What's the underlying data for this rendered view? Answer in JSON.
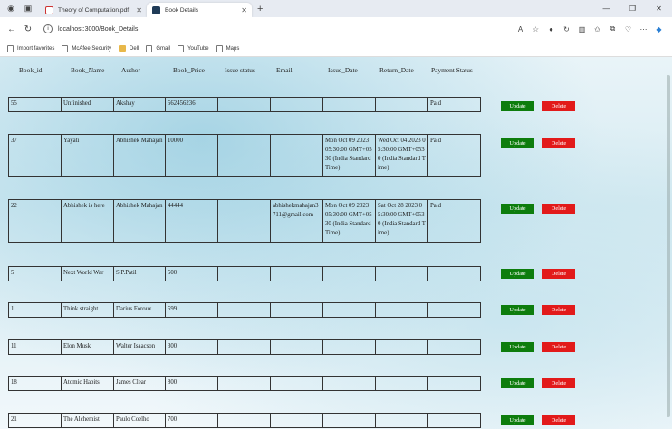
{
  "browser": {
    "tabs": [
      {
        "title": "Theory of Computation.pdf"
      },
      {
        "title": "Book Details"
      }
    ],
    "url": "localhost:3000/Book_Details",
    "favorites": [
      "Import favorites",
      "McAfee Security",
      "Dell",
      "Gmail",
      "YouTube",
      "Maps"
    ]
  },
  "table": {
    "headers": [
      "Book_id",
      "Book_Name",
      "Author",
      "Book_Price",
      "Issue status",
      "Email",
      "Issue_Date",
      "Return_Date",
      "Payment Status"
    ],
    "update_label": "Update",
    "delete_label": "Delete",
    "rows": [
      {
        "id": "55",
        "name": "Unfinished",
        "author": "Akshay",
        "price": "562456236",
        "status": "",
        "email": "",
        "issue": "",
        "ret": "",
        "payment": "Paid"
      },
      {
        "id": "37",
        "name": "Yayati",
        "author": "Abhishek Mahajan",
        "price": "10000",
        "status": "",
        "email": "",
        "issue": "Mon Oct 09 2023 05:30:00 GMT+0530 (India Standard Time)",
        "ret": "Wed Oct 04 2023 05:30:00 GMT+0530 (India Standard Time)",
        "payment": "Paid"
      },
      {
        "id": "22",
        "name": "Abhishek is here",
        "author": "Abhishek Mahajan",
        "price": "44444",
        "status": "",
        "email": "abhishekmahajan3711@gmail.com",
        "issue": "Mon Oct 09 2023 05:30:00 GMT+0530 (India Standard Time)",
        "ret": "Sat Oct 28 2023 05:30:00 GMT+0530 (India Standard Time)",
        "payment": "Paid"
      },
      {
        "id": "5",
        "name": "Next World War",
        "author": "S.P.Patil",
        "price": "500",
        "status": "",
        "email": "",
        "issue": "",
        "ret": "",
        "payment": ""
      },
      {
        "id": "1",
        "name": "Think straight",
        "author": "Darius Foroux",
        "price": "599",
        "status": "",
        "email": "",
        "issue": "",
        "ret": "",
        "payment": ""
      },
      {
        "id": "11",
        "name": "Elon Musk",
        "author": "Walter Isaacson",
        "price": "300",
        "status": "",
        "email": "",
        "issue": "",
        "ret": "",
        "payment": ""
      },
      {
        "id": "18",
        "name": "Atomic Habits",
        "author": "James Clear",
        "price": "800",
        "status": "",
        "email": "",
        "issue": "",
        "ret": "",
        "payment": ""
      },
      {
        "id": "21",
        "name": "The Alchemist",
        "author": "Paulo Coelho",
        "price": "700",
        "status": "",
        "email": "",
        "issue": "",
        "ret": "",
        "payment": ""
      }
    ]
  }
}
